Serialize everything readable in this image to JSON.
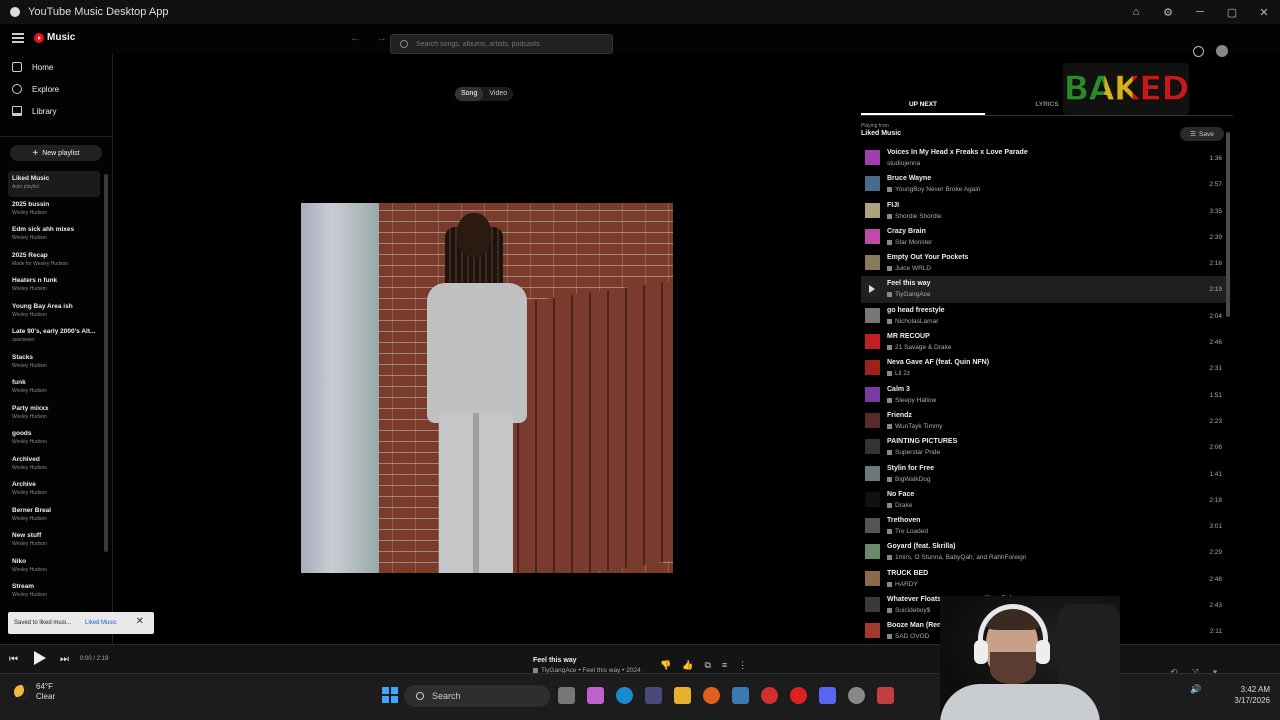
{
  "window": {
    "title": "YouTube Music Desktop App",
    "controls": [
      "⌂",
      "⚙",
      "─",
      "▢",
      "✕"
    ]
  },
  "header": {
    "logo_text": "Music",
    "back": "←",
    "forward": "→",
    "search_placeholder": "Search songs, albums, artists, podcasts"
  },
  "sidebar": {
    "nav": [
      {
        "label": "Home",
        "icon": "home-icon"
      },
      {
        "label": "Explore",
        "icon": "explore-icon"
      },
      {
        "label": "Library",
        "icon": "library-icon"
      }
    ],
    "new_playlist": "New playlist",
    "playlists": [
      {
        "name": "Liked Music",
        "sub": "Auto playlist"
      },
      {
        "name": "2025 bussin",
        "sub": "Wesley Hudson"
      },
      {
        "name": "Edm sick ahh mixes",
        "sub": "Wesley Hudson"
      },
      {
        "name": "2025 Recap",
        "sub": "Made for Wesley Hudson"
      },
      {
        "name": "Heaters n funk",
        "sub": "Wesley Hudson"
      },
      {
        "name": "Young Bay Area ish",
        "sub": "Wesley Hudson"
      },
      {
        "name": "Late 90's, early 2000's Alt...",
        "sub": "quietwiser"
      },
      {
        "name": "Stacks",
        "sub": "Wesley Hudson"
      },
      {
        "name": "funk",
        "sub": "Wesley Hudson"
      },
      {
        "name": "Party mixxx",
        "sub": "Wesley Hudson"
      },
      {
        "name": "goods",
        "sub": "Wesley Hudson"
      },
      {
        "name": "Archived",
        "sub": "Wesley Hudson"
      },
      {
        "name": "Archive",
        "sub": "Wesley Hudson"
      },
      {
        "name": "Berner Breal",
        "sub": "Wesley Hudson"
      },
      {
        "name": "New stuff",
        "sub": "Wesley Hudson"
      },
      {
        "name": "Niko",
        "sub": "Wesley Hudson"
      },
      {
        "name": "Stream",
        "sub": "Wesley Hudson"
      }
    ]
  },
  "toggle": {
    "song": "Song",
    "video": "Video",
    "selected": "Song"
  },
  "right_panel": {
    "tabs": [
      "UP NEXT",
      "LYRICS"
    ],
    "brand_logo": "BAKED",
    "playing_from_label": "Playing from",
    "playing_from": "Liked Music",
    "save": "Save",
    "queue": [
      {
        "title": "Voices In My Head x Freaks x Love Parade",
        "artist": "studiojenna",
        "duration": "1:36",
        "explicit": false,
        "thumb": "#a040b0"
      },
      {
        "title": "Bruce Wayne",
        "artist": "YoungBoy Never Broke Again",
        "duration": "2:57",
        "explicit": true,
        "thumb": "#4a6a8a"
      },
      {
        "title": "FIJI",
        "artist": "Shordie Shordie",
        "duration": "3:35",
        "explicit": true,
        "thumb": "#b0a080"
      },
      {
        "title": "Crazy Brain",
        "artist": "Star Monster",
        "duration": "2:39",
        "explicit": true,
        "thumb": "#c04aa8"
      },
      {
        "title": "Empty Out Your Pockets",
        "artist": "Juice WRLD",
        "duration": "2:16",
        "explicit": true,
        "thumb": "#8a7a5a"
      },
      {
        "title": "Feel this way",
        "artist": "TiyGangAce",
        "duration": "2:19",
        "explicit": true,
        "thumb": "#222",
        "current": true
      },
      {
        "title": "go head freestyle",
        "artist": "NicholasLamar",
        "duration": "2:04",
        "explicit": true,
        "thumb": "#777"
      },
      {
        "title": "MR RECOUP",
        "artist": "21 Savage & Drake",
        "duration": "2:46",
        "explicit": true,
        "thumb": "#c02020"
      },
      {
        "title": "Neva Gave AF (feat. Quin NFN)",
        "artist": "Lil 2z",
        "duration": "2:31",
        "explicit": true,
        "thumb": "#a0201a"
      },
      {
        "title": "Calm 3",
        "artist": "Sleepy Hallow",
        "duration": "1:51",
        "explicit": true,
        "thumb": "#7a3aa0"
      },
      {
        "title": "Friendz",
        "artist": "WunTayk Timmy",
        "duration": "2:23",
        "explicit": true,
        "thumb": "#5a2a2a"
      },
      {
        "title": "PAINTING PICTURES",
        "artist": "Superstar Pride",
        "duration": "2:06",
        "explicit": true,
        "thumb": "#333"
      },
      {
        "title": "Stylin for Free",
        "artist": "BigWalkDog",
        "duration": "1:41",
        "explicit": true,
        "thumb": "#6a7a7a"
      },
      {
        "title": "No Face",
        "artist": "Drake",
        "duration": "2:18",
        "explicit": true,
        "thumb": "#111"
      },
      {
        "title": "Trethoven",
        "artist": "Tre Loaded",
        "duration": "3:01",
        "explicit": true,
        "thumb": "#555"
      },
      {
        "title": "Goyard (feat. Skrilla)",
        "artist": "1mirs, O Stunna, BabyQah, and RahhForeign",
        "duration": "2:29",
        "explicit": true,
        "thumb": "#6a8a6a"
      },
      {
        "title": "TRUCK BED",
        "artist": "HARDY",
        "duration": "2:48",
        "explicit": true,
        "thumb": "#8a6a4a"
      },
      {
        "title": "Whatever Floats Your Boat Will Definit...",
        "artist": "Suicideboy$",
        "duration": "2:43",
        "explicit": true,
        "thumb": "#3a3a3a"
      },
      {
        "title": "Booze Man (Remix)",
        "artist": "SAD OVOD",
        "duration": "2:11",
        "explicit": true,
        "thumb": "#a03a2a"
      }
    ]
  },
  "player": {
    "time": "0:00 / 2:19",
    "now_playing_title": "Feel this way",
    "now_playing_sub": "TiyGangAce • Feel this way • 2024",
    "actions": [
      "dislike",
      "like",
      "save",
      "queue",
      "more"
    ]
  },
  "toast": {
    "message": "Saved to liked musi...",
    "link": "Liked Music",
    "close": "✕"
  },
  "taskbar": {
    "temp": "64°F",
    "weather": "Clear",
    "search": "Search",
    "time": "3:42 AM",
    "date": "3/17/2026"
  },
  "colors": {
    "accent": "#ff0000",
    "background": "#030303",
    "start": "#3fa5ff"
  }
}
